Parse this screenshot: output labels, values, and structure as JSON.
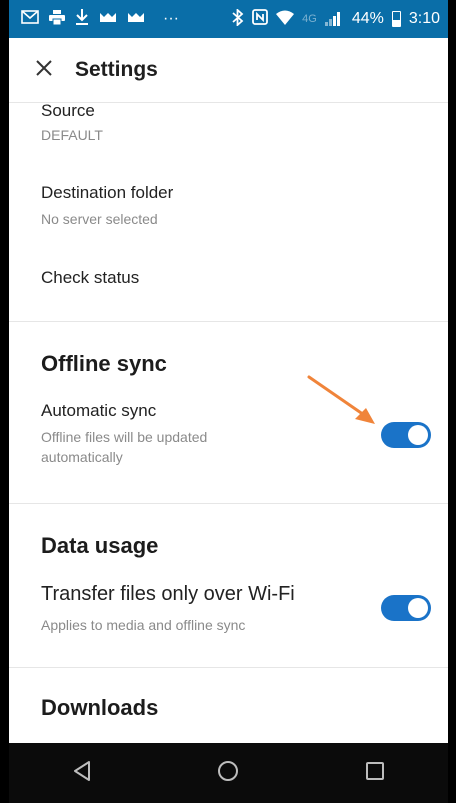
{
  "status_bar": {
    "network": "4G",
    "battery": "44%",
    "time": "3:10",
    "more_indicator": "···"
  },
  "app_bar": {
    "title": "Settings",
    "close_icon": "close-icon"
  },
  "settings": {
    "source": {
      "label": "Source",
      "value": "DEFAULT"
    },
    "destination": {
      "label": "Destination folder",
      "value": "No server selected"
    },
    "check_status": {
      "label": "Check status"
    },
    "offline_sync": {
      "section_title": "Offline sync",
      "automatic_sync": {
        "label": "Automatic sync",
        "description_line1": "Offline files will be updated",
        "description_line2": "automatically",
        "enabled": true
      }
    },
    "data_usage": {
      "section_title": "Data usage",
      "wifi_only": {
        "label": "Transfer files only over Wi-Fi",
        "description": "Applies to media and offline sync",
        "enabled": true
      }
    },
    "downloads": {
      "section_title": "Downloads"
    }
  },
  "colors": {
    "status_bar": "#0a6ea8",
    "toggle_on": "#1a73c8",
    "annotation_arrow": "#f0843a"
  },
  "nav_bar": {
    "back_icon": "back-triangle-icon",
    "home_icon": "home-circle-icon",
    "recents_icon": "recents-square-icon"
  }
}
